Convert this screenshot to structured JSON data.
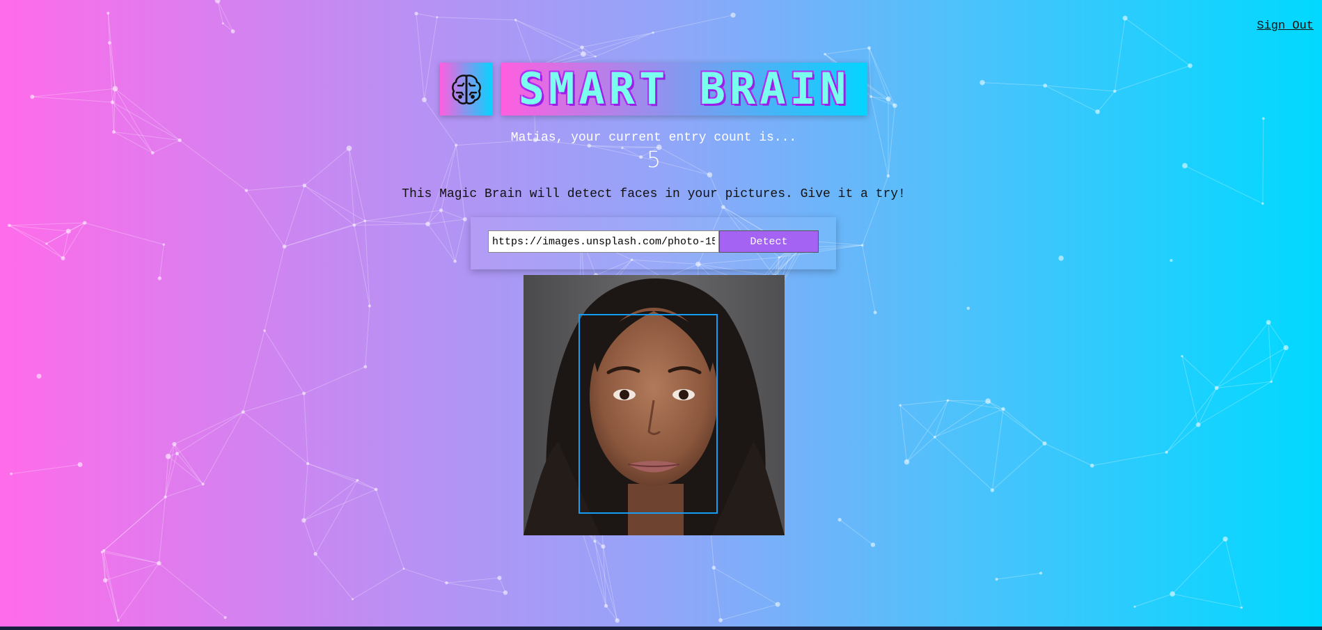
{
  "header": {
    "sign_out_label": "Sign Out"
  },
  "logo": {
    "icon": "brain-icon",
    "brand_title": "SMART BRAIN"
  },
  "rank": {
    "message": "Matias, your current entry count is...",
    "count": "5"
  },
  "image_link_form": {
    "tagline": "This Magic Brain will detect faces in your pictures. Give it a try!",
    "url_value": "https://images.unsplash.com/photo-15",
    "detect_label": "Detect"
  },
  "face_recognition": {
    "image_subject": "portrait photo of a woman",
    "face_box_color": "#149df2"
  },
  "colors": {
    "gradient_start": "#ff6bea",
    "gradient_end": "#00d9ff",
    "button": "#a463f2"
  }
}
